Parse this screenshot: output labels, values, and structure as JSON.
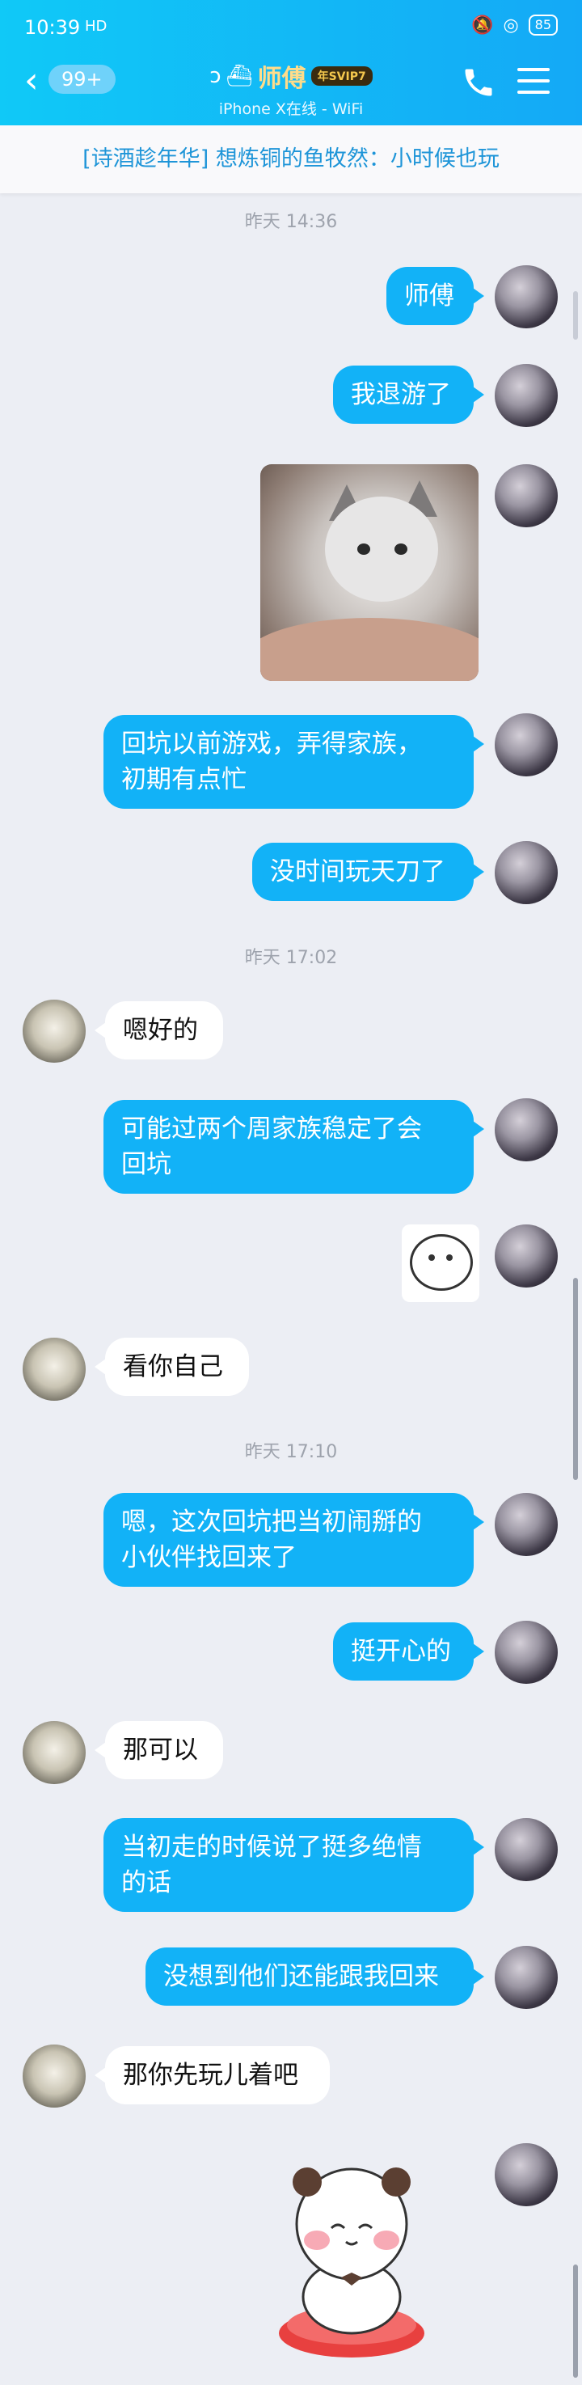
{
  "status_bar": {
    "time": "10:39",
    "signal": "HD",
    "battery": "85"
  },
  "header": {
    "back_count": "99+",
    "contact_name": "师傅",
    "vip_badge": "年SVIP7",
    "subtitle": "iPhone X在线 - WiFi"
  },
  "notice": {
    "text": "[诗酒趁年华] 想炼铜的鱼牧然：小时候也玩"
  },
  "colors": {
    "accent": "#12b2f7",
    "header": "#14a9f6",
    "background": "#eceef4"
  },
  "timestamps": [
    "昨天 14:36",
    "昨天 17:02",
    "昨天 17:10"
  ],
  "messages": [
    {
      "from": "me",
      "type": "text",
      "text": "师傅"
    },
    {
      "from": "me",
      "type": "text",
      "text": "我退游了"
    },
    {
      "from": "me",
      "type": "image",
      "image": "kitten-photo"
    },
    {
      "from": "me",
      "type": "text",
      "text": "回坑以前游戏，弄得家族，\n初期有点忙"
    },
    {
      "from": "me",
      "type": "text",
      "text": "没时间玩天刀了"
    },
    {
      "from": "other",
      "type": "text",
      "text": "嗯好的"
    },
    {
      "from": "me",
      "type": "text",
      "text": "可能过两个周家族稳定了会\n回坑"
    },
    {
      "from": "me",
      "type": "sticker",
      "image": "blob-face-sticker"
    },
    {
      "from": "other",
      "type": "text",
      "text": "看你自己"
    },
    {
      "from": "me",
      "type": "text",
      "text": "嗯，这次回坑把当初闹掰的\n小伙伴找回来了"
    },
    {
      "from": "me",
      "type": "text",
      "text": "挺开心的"
    },
    {
      "from": "other",
      "type": "text",
      "text": "那可以"
    },
    {
      "from": "me",
      "type": "text",
      "text": "当初走的时候说了挺多绝情\n的话"
    },
    {
      "from": "me",
      "type": "text",
      "text": "没想到他们还能跟我回来"
    },
    {
      "from": "other",
      "type": "text",
      "text": "那你先玩儿着吧"
    },
    {
      "from": "me",
      "type": "sticker",
      "image": "panda-sticker"
    }
  ]
}
